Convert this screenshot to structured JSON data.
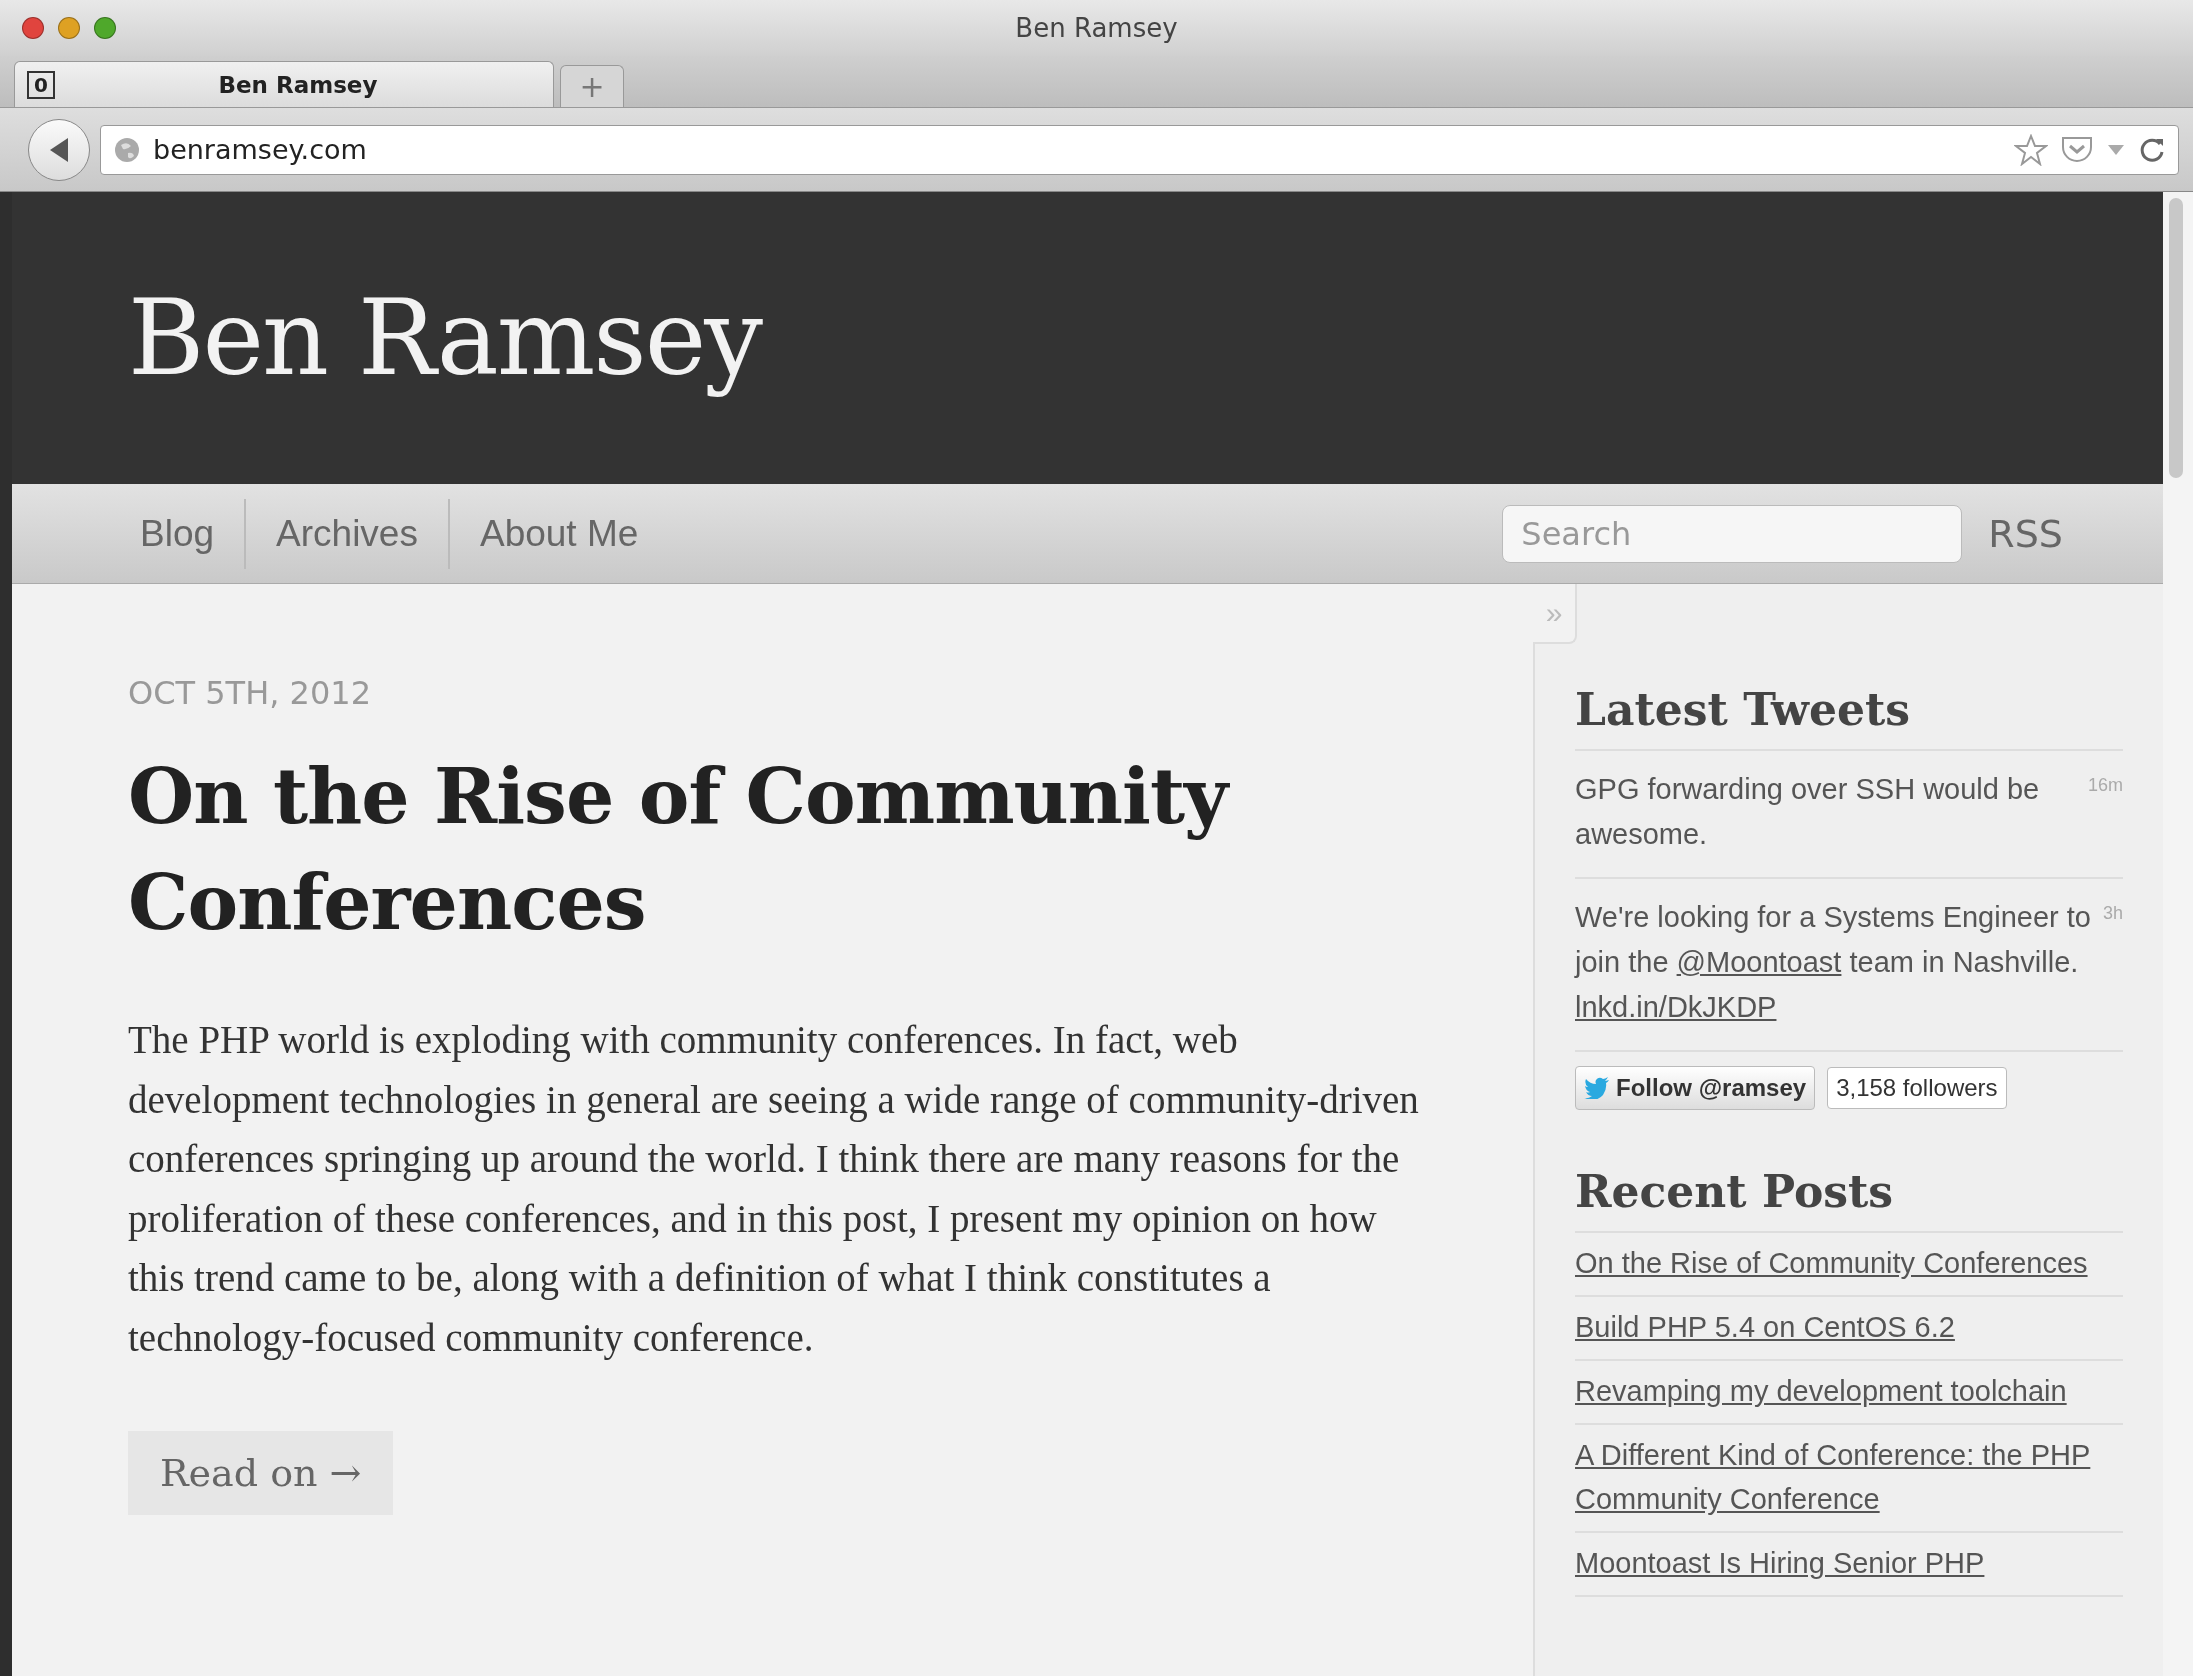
{
  "window": {
    "title": "Ben Ramsey"
  },
  "tabs": [
    {
      "label": "Ben Ramsey",
      "selected": true
    }
  ],
  "tab_badge": "0",
  "new_tab": "+",
  "address_bar": {
    "value": "benramsey.com"
  },
  "site": {
    "title": "Ben Ramsey"
  },
  "nav": {
    "items": [
      {
        "label": "Blog"
      },
      {
        "label": "Archives"
      },
      {
        "label": "About Me"
      }
    ],
    "search": {
      "placeholder": "Search"
    },
    "rss": "RSS"
  },
  "sidebar_toggle": "»",
  "post": {
    "date": "OCT 5TH, 2012",
    "title": "On the Rise of Community Conferences",
    "body": "The PHP world is exploding with community conferences. In fact, web development technologies in general are seeing a wide range of community-driven conferences springing up around the world. I think there are many reasons for the proliferation of these conferences, and in this post, I present my opinion on how this trend came to be, along with a definition of what I think constitutes a technology-focused community conference.",
    "read_more": "Read on →"
  },
  "sidebar": {
    "tweets_title": "Latest Tweets",
    "tweets": [
      {
        "time": "16m",
        "parts": [
          {
            "kind": "text",
            "text": "GPG forwarding over SSH would be awesome."
          }
        ]
      },
      {
        "time": "3h",
        "parts": [
          {
            "kind": "text",
            "text": "We're looking for a Systems Engineer to join the "
          },
          {
            "kind": "link",
            "text": "@Moontoast"
          },
          {
            "kind": "text",
            "text": " team in Nashville. "
          },
          {
            "kind": "link",
            "text": "lnkd.in/DkJKDP"
          }
        ]
      }
    ],
    "follow_button": "Follow @ramsey",
    "followers": "3,158 followers",
    "posts_title": "Recent Posts",
    "posts": [
      "On the Rise of Community Conferences",
      "Build PHP 5.4 on CentOS 6.2",
      "Revamping my development toolchain",
      "A Different Kind of Conference: the PHP Community Conference",
      "Moontoast Is Hiring Senior PHP"
    ]
  }
}
